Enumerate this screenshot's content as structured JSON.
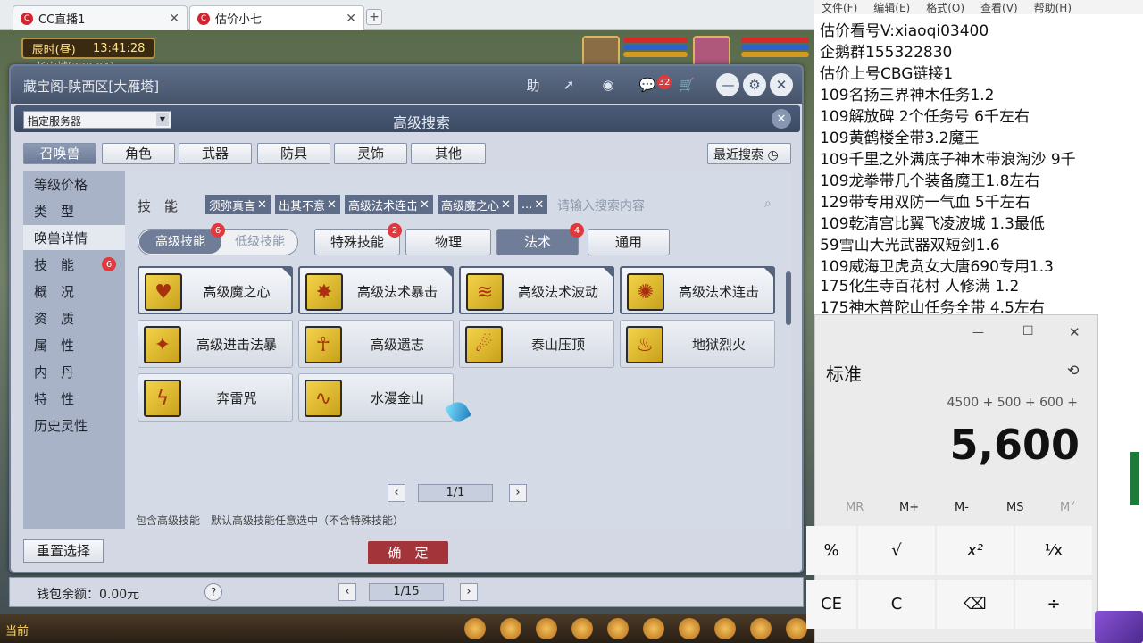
{
  "browser": {
    "tabs": [
      {
        "label": "CC直播1",
        "icon": "cc-logo-icon"
      },
      {
        "label": "估价小七",
        "icon": "cc-logo-icon"
      }
    ],
    "new_tab": "+"
  },
  "game": {
    "time": "辰时(昼)",
    "clock": "13:41:28",
    "location": "长安城[239,84]"
  },
  "window": {
    "title": "藏宝阁-陕西区[大雁塔]",
    "btn_help": "助",
    "chat_count": "32"
  },
  "search": {
    "server_select": "指定服务器",
    "title": "高级搜索",
    "categories": [
      "召唤兽",
      "角色",
      "武器",
      "防具",
      "灵饰",
      "其他"
    ],
    "recent": "最近搜索",
    "left_nav": [
      "等级价格",
      "类　型",
      "唤兽详情",
      "技　能",
      "概　况",
      "资　质",
      "属　性",
      "内　丹",
      "特　性",
      "历史灵性"
    ],
    "skill_badge": "6",
    "skill_label": "技　能",
    "chips": [
      "须弥真言",
      "出其不意",
      "高级法术连击",
      "高级魔之心",
      "..."
    ],
    "search_placeholder": "请输入搜索内容",
    "level_toggle": {
      "high": "高级技能",
      "low": "低级技能",
      "high_badge": "6"
    },
    "sub_tabs": [
      {
        "label": "特殊技能",
        "badge": "2"
      },
      {
        "label": "物理",
        "badge": ""
      },
      {
        "label": "法术",
        "badge": "4"
      },
      {
        "label": "通用",
        "badge": ""
      }
    ],
    "skills": [
      {
        "label": "高级魔之心",
        "selected": true
      },
      {
        "label": "高级法术暴击",
        "selected": true
      },
      {
        "label": "高级法术波动",
        "selected": true
      },
      {
        "label": "高级法术连击",
        "selected": true
      },
      {
        "label": "高级进击法暴",
        "selected": false
      },
      {
        "label": "高级遗志",
        "selected": false
      },
      {
        "label": "泰山压顶",
        "selected": false
      },
      {
        "label": "地狱烈火",
        "selected": false
      },
      {
        "label": "奔雷咒",
        "selected": false
      },
      {
        "label": "水漫金山",
        "selected": false
      }
    ],
    "page": "1/1",
    "footer_note": "包含高级技能　默认高级技能任意选中（不含特殊技能）",
    "reset": "重置选择",
    "confirm": "确　定"
  },
  "wallet": {
    "label": "钱包余额：0.00元",
    "help": "?",
    "page": "1/15"
  },
  "bottom": {
    "current": "当前"
  },
  "notepad": {
    "menu": [
      "文件(F)",
      "编辑(E)",
      "格式(O)",
      "查看(V)",
      "帮助(H)"
    ],
    "lines": [
      "估价看号V:xiaoqi03400",
      "企鹅群155322830",
      "估价上号CBG链接1",
      "109名扬三界神木任务1.2",
      "109解放碑 2个任务号 6千左右",
      "109黄鹤楼全带3.2魔王",
      "109千里之外满底子神木带浪淘沙 9千",
      "109龙拳带几个装备魔王1.8左右",
      "129带专用双防一气血 5千左右",
      "109乾清宫比翼飞凌波城 1.3最低",
      "59雪山大光武器双短剑1.6",
      "109威海卫虎贲女大唐690专用1.3",
      "175化生寺百花村 人修满 1.2",
      "175神木普陀山任务全带 4.5左右"
    ]
  },
  "calculator": {
    "mode": "标准",
    "expression": "4500 + 500 + 600 +",
    "display": "5,600",
    "memory": [
      "MR",
      "M+",
      "M-",
      "MS",
      "M˅"
    ],
    "keys": [
      "%",
      "√",
      "x²",
      "⅟x",
      "CE",
      "C",
      "⌫",
      "÷"
    ]
  },
  "colors": {
    "accent_red": "#a3343a",
    "badge_red": "#e0383d",
    "window_header": "#46546b"
  }
}
